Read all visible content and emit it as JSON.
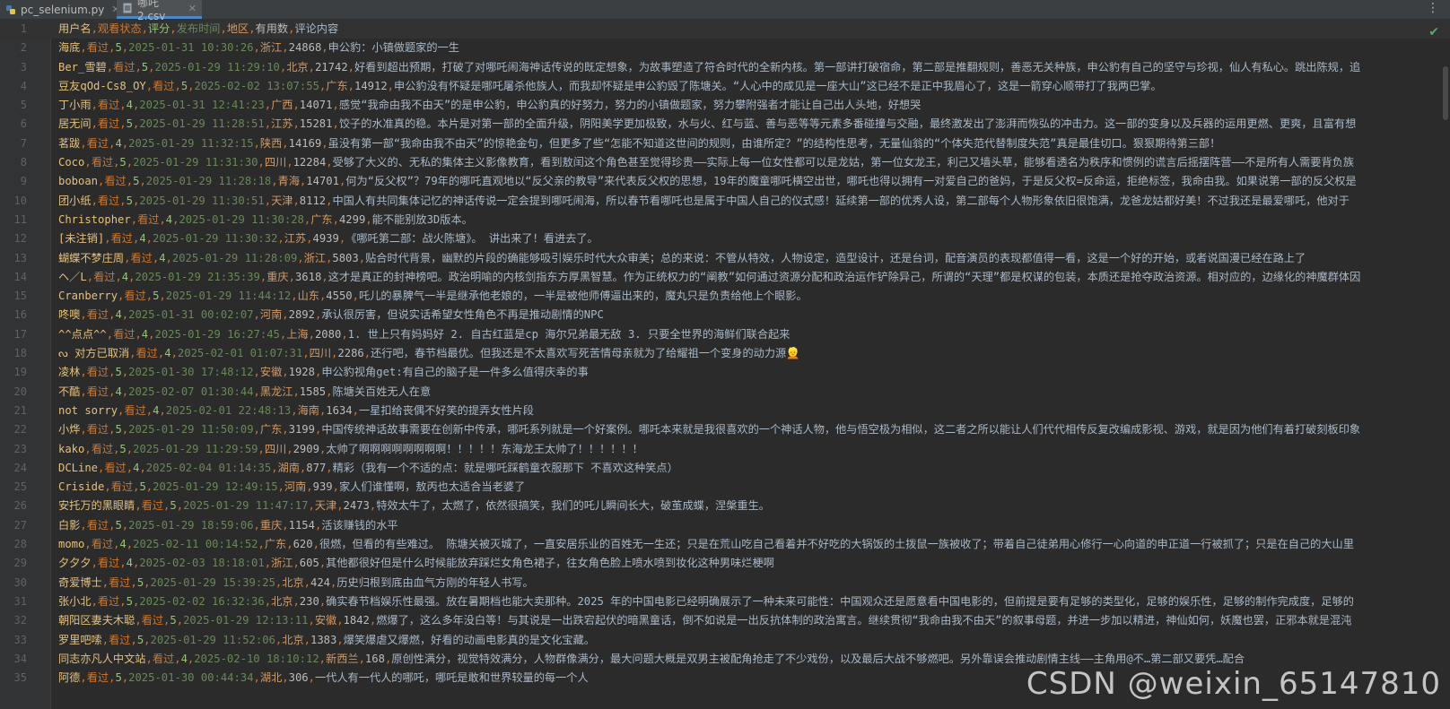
{
  "tabs": [
    {
      "label": "pc_selenium.py",
      "icon": "python-file-icon",
      "active": false
    },
    {
      "label": "哪吒2.csv",
      "icon": "csv-file-icon",
      "active": true
    }
  ],
  "watermark": "CSDN @weixin_65147810",
  "lines": [
    {
      "n": "1",
      "f": [
        "用户名",
        "观看状态",
        "评分",
        "发布时间",
        "地区",
        "有用数",
        "评论内容"
      ]
    },
    {
      "n": "2",
      "f": [
        "海底",
        "看过",
        "5",
        "2025-01-31 10:30:26",
        "浙江",
        "24868",
        "申公豹：小镇做题家的一生"
      ]
    },
    {
      "n": "3",
      "f": [
        "Ber_雪碧",
        "看过",
        "5",
        "2025-01-29 11:29:10",
        "北京",
        "21742",
        "好看到超出预期，打破了对哪吒闹海神话传说的既定想象，为故事塑造了符合时代的全新内核。第一部讲打破宿命，第二部是推翻规则，善恶无关种族，申公豹有自己的坚守与珍视，仙人有私心。跳出陈规，追"
      ]
    },
    {
      "n": "4",
      "f": [
        "豆友qOd-Cs8_OY",
        "看过",
        "5",
        "2025-02-02 13:07:55",
        "广东",
        "14912",
        "申公豹没有怀疑是哪吒屠杀他族人，而我却怀疑是申公豹毁了陈塘关。“人心中的成见是一座大山”这已经不是正中我眉心了，这是一箭穿心顺带打了我两巴掌。"
      ]
    },
    {
      "n": "5",
      "f": [
        "丁小雨",
        "看过",
        "4",
        "2025-01-31 12:41:23",
        "广西",
        "14071",
        "感觉“我命由我不由天”的是申公豹，申公豹真的好努力，努力的小镇做题家，努力攀附强者才能让自己出人头地，好想哭"
      ]
    },
    {
      "n": "6",
      "f": [
        "居无间",
        "看过",
        "5",
        "2025-01-29 11:28:51",
        "江苏",
        "15281",
        "饺子的水准真的稳。本片是对第一部的全面升级，阴阳美学更加极致，水与火、红与蓝、善与恶等等元素多番碰撞与交融，最终激发出了澎湃而恢弘的冲击力。这一部的变身以及兵器的运用更燃、更爽，且富有想"
      ]
    },
    {
      "n": "7",
      "f": [
        "茗跋",
        "看过",
        "4",
        "2025-01-29 11:32:15",
        "陕西",
        "14169",
        "虽没有第一部“我命由我不由天”的惊艳金句，但更多了些“怎能不知道这世间的规则，由谁所定？”的结构性思考，无量仙翁的“个体失范代替制度失范”真是最佳切口。狠狠期待第三部！"
      ]
    },
    {
      "n": "8",
      "f": [
        "Coco",
        "看过",
        "5",
        "2025-01-29 11:31:30",
        "四川",
        "12284",
        "受够了大义的、无私的集体主义影像教育，看到敖闰这个角色甚至觉得珍贵——实际上每一位女性都可以是龙姑，第一位女龙王，利己又墙头草，能够看透名为秩序和惯例的谎言后摇摆阵营——不是所有人需要背负族"
      ]
    },
    {
      "n": "9",
      "f": [
        "boboan",
        "看过",
        "5",
        "2025-01-29 11:28:18",
        "青海",
        "14701",
        "何为“反父权”？79年的哪吒直观地以“反父亲的教导”来代表反父权的思想，19年的魔童哪吒横空出世，哪吒也得以拥有一对爱自己的爸妈，于是反父权=反命运，拒绝标签，我命由我。如果说第一部的反父权是"
      ]
    },
    {
      "n": "10",
      "f": [
        "团小纸",
        "看过",
        "5",
        "2025-01-29 11:30:51",
        "天津",
        "8112",
        "中国人有共同集体记忆的神话传说一定会提到哪吒闹海，所以春节看哪吒也是属于中国人自己的仪式感！延续第一部的优秀人设，第二部每个人物形象依旧很饱满，龙爸龙姑都好美！不过我还是最爱哪吒，他对于"
      ]
    },
    {
      "n": "11",
      "f": [
        "Christopher",
        "看过",
        "4",
        "2025-01-29 11:30:28",
        "广东",
        "4299",
        "能不能别放3D版本。"
      ]
    },
    {
      "n": "12",
      "f": [
        "[未注销]",
        "看过",
        "4",
        "2025-01-29 11:30:32",
        "江苏",
        "4939",
        "《哪吒第二部：战火陈塘》。 讲出来了！看进去了。"
      ]
    },
    {
      "n": "13",
      "f": [
        "蝴蝶不梦庄周",
        "看过",
        "4",
        "2025-01-29 11:28:09",
        "浙江",
        "5803",
        "贴合时代背景，幽默的片段的确能够吸引娱乐时代大众审美；总的来说：不管从特效，人物设定，造型设计，还是台词，配音演员的表现都值得一看，这是一个好的开始，或者说国漫已经在路上了"
      ]
    },
    {
      "n": "14",
      "f": [
        "ヘ／L",
        "看过",
        "4",
        "2025-01-29 21:35:39",
        "重庆",
        "3618",
        "这才是真正的封神榜吧。政治明喻的内核剑指东方厚黑智慧。作为正统权力的“阐教”如何通过资源分配和政治运作铲除异己，所谓的“天理”都是权谋的包装，本质还是抢夺政治资源。相对应的，边缘化的神魔群体因"
      ]
    },
    {
      "n": "15",
      "f": [
        "Cranberry",
        "看过",
        "5",
        "2025-01-29 11:44:12",
        "山东",
        "4550",
        "吒儿的暴脾气一半是继承他老娘的，一半是被他师傅逼出来的，魔丸只是负责给他上个眼影。"
      ]
    },
    {
      "n": "16",
      "f": [
        "咚噢",
        "看过",
        "4",
        "2025-01-31 00:02:07",
        "河南",
        "2892",
        "承认很厉害，但说实话希望女性角色不再是推动剧情的NPC"
      ]
    },
    {
      "n": "17",
      "f": [
        "^^点点^^",
        "看过",
        "4",
        "2025-01-29 16:27:45",
        "上海",
        "2080",
        "1. 世上只有妈妈好 2. 自古红蓝是cp 海尔兄弟最无敌 3. 只要全世界的海鲜们联合起来"
      ]
    },
    {
      "n": "18",
      "f": [
        "ᔓ 对方已取消",
        "看过",
        "4",
        "2025-02-01 01:07:31",
        "四川",
        "2286",
        "还行吧，春节档最优。但我还是不太喜欢写死苦情母亲就为了给耀祖一个变身的动力源👱"
      ]
    },
    {
      "n": "19",
      "f": [
        "凌林",
        "看过",
        "5",
        "2025-01-30 17:48:12",
        "安徽",
        "1928",
        "申公豹视角get:有自己的脑子是一件多么值得庆幸的事"
      ]
    },
    {
      "n": "20",
      "f": [
        "不酷",
        "看过",
        "4",
        "2025-02-07 01:30:44",
        "黑龙江",
        "1585",
        "陈塘关百姓无人在意"
      ]
    },
    {
      "n": "21",
      "f": [
        "not sorry",
        "看过",
        "4",
        "2025-02-01 22:48:13",
        "海南",
        "1634",
        "一星扣给丧偶不好笑的提弄女性片段"
      ]
    },
    {
      "n": "22",
      "f": [
        "小烨",
        "看过",
        "5",
        "2025-01-29 11:50:09",
        "广东",
        "3199",
        "中国传统神话故事需要在创新中传承，哪吒系列就是一个好案例。哪吒本来就是我很喜欢的一个神话人物，他与悟空极为相似，这二者之所以能让人们代代相传反复改编成影视、游戏，就是因为他们有着打破刻板印象"
      ]
    },
    {
      "n": "23",
      "f": [
        "kako",
        "看过",
        "5",
        "2025-01-29 11:29:59",
        "四川",
        "2909",
        "太帅了啊啊啊啊啊啊啊啊！！！！！东海龙王太帅了！！！！！！"
      ]
    },
    {
      "n": "24",
      "f": [
        "DCLine",
        "看过",
        "4",
        "2025-02-04 01:14:35",
        "湖南",
        "877",
        "精彩（我有一个不适的点：就是哪吒踩鹤童衣服那下 不喜欢这种笑点）"
      ]
    },
    {
      "n": "25",
      "f": [
        "Criside",
        "看过",
        "5",
        "2025-01-29 12:49:15",
        "河南",
        "939",
        "家人们谁懂啊，敖丙也太适合当老婆了"
      ]
    },
    {
      "n": "26",
      "f": [
        "安托万的黑眼睛",
        "看过",
        "5",
        "2025-01-29 11:47:17",
        "天津",
        "2473",
        "特效太牛了，太燃了，依然很搞笑，我们的吒儿瞬间长大，破茧成蝶，涅槃重生。"
      ]
    },
    {
      "n": "27",
      "f": [
        "白影",
        "看过",
        "5",
        "2025-01-29 18:59:06",
        "重庆",
        "1154",
        "活该赚钱的水平"
      ]
    },
    {
      "n": "28",
      "f": [
        "momo",
        "看过",
        "4",
        "2025-02-11 00:14:52",
        "广东",
        "620",
        "很燃，但看的有些难过。 陈塘关被灭城了，一直安居乐业的百姓无一生还；只是在荒山吃自己看着并不好吃的大锅饭的土拨鼠一族被收了；带着自己徒弟用心修行一心向道的申正道一行被抓了；只是在自己的大山里"
      ]
    },
    {
      "n": "29",
      "f": [
        "夕夕夕",
        "看过",
        "4",
        "2025-02-03 18:18:01",
        "浙江",
        "605",
        "其他都很好但是什么时候能放弃踩烂女角色裙子，往女角色脸上喷水喷到妆化这种男味烂梗啊"
      ]
    },
    {
      "n": "30",
      "f": [
        "奇爱博士",
        "看过",
        "5",
        "2025-01-29 15:39:25",
        "北京",
        "424",
        "历史归根到底由血气方刚的年轻人书写。"
      ]
    },
    {
      "n": "31",
      "f": [
        "张小北",
        "看过",
        "5",
        "2025-02-02 16:32:36",
        "北京",
        "230",
        "确实春节档娱乐性最强。放在暑期档也能大卖那种。2025 年的中国电影已经明确展示了一种未来可能性：中国观众还是愿意看中国电影的，但前提是要有足够的类型化，足够的娱乐性，足够的制作完成度，足够的"
      ]
    },
    {
      "n": "32",
      "f": [
        "朝阳区妻夫木聪",
        "看过",
        "5",
        "2025-01-29 12:13:11",
        "安徽",
        "1842",
        "燃爆了，这么多年没白等！与其说是一出跌宕起伏的暗黑童话，倒不如说是一出反抗体制的政治寓言。继续贯彻“我命由我不由天”的叙事母题，并进一步加以精进，神仙如何，妖魔也罢，正邪本就是混沌"
      ]
    },
    {
      "n": "33",
      "f": [
        "罗里吧嗦",
        "看过",
        "5",
        "2025-01-29 11:52:06",
        "北京",
        "1383",
        "爆笑爆虐又爆燃，好看的动画电影真的是文化宝藏。"
      ]
    },
    {
      "n": "34",
      "f": [
        "同志亦凡人中文站",
        "看过",
        "4",
        "2025-02-10 18:10:12",
        "新西兰",
        "168",
        "原创性满分，视觉特效满分，人物群像满分，最大问题大概是双男主被配角抢走了不少戏份，以及最后大战不够燃吧。另外靠误会推动剧情主线——主角用@不…第二部又要凭…配合"
      ]
    },
    {
      "n": "35",
      "f": [
        "阿德",
        "看过",
        "5",
        "2025-01-30 00:44:34",
        "湖北",
        "306",
        "一代人有一代人的哪吒，哪吒是敢和世界较量的每一个人"
      ]
    }
  ]
}
